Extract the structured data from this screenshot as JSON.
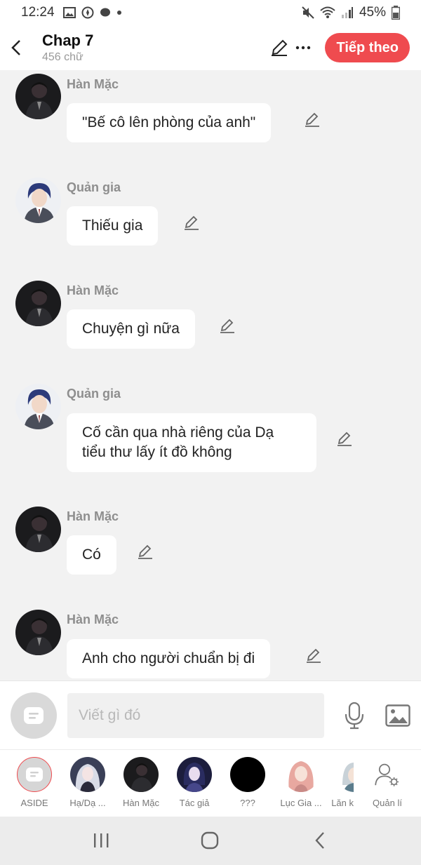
{
  "status_bar": {
    "time": "12:24",
    "battery": "45%"
  },
  "header": {
    "title": "Chap 7",
    "subtitle": "456 chữ",
    "next_label": "Tiếp theo"
  },
  "messages": [
    {
      "name": "Hàn Mặc",
      "text": "\"Bế cô lên phòng của anh\""
    },
    {
      "name": "Quản gia",
      "text": "Thiếu gia"
    },
    {
      "name": "Hàn Mặc",
      "text": "Chuyện gì nữa"
    },
    {
      "name": "Quản gia",
      "text": "Cố cần qua nhà riêng của Dạ tiểu thư lấy ít đồ không"
    },
    {
      "name": "Hàn Mặc",
      "text": "Có"
    },
    {
      "name": "Hàn Mặc",
      "text": "Anh cho người chuẩn bị đi"
    }
  ],
  "input": {
    "placeholder": "Viết gì đó"
  },
  "characters": [
    {
      "label": "ASIDE"
    },
    {
      "label": "Hạ/Dạ ..."
    },
    {
      "label": "Hàn Mặc"
    },
    {
      "label": "Tác giả"
    },
    {
      "label": "???"
    },
    {
      "label": "Lục Gia ..."
    },
    {
      "label": "Lăn k"
    },
    {
      "label": "Quản lí"
    }
  ],
  "colors": {
    "accent": "#ef4b4f",
    "background": "#f2f2f2",
    "bubble": "#ffffff",
    "name": "#8e8e8e"
  }
}
